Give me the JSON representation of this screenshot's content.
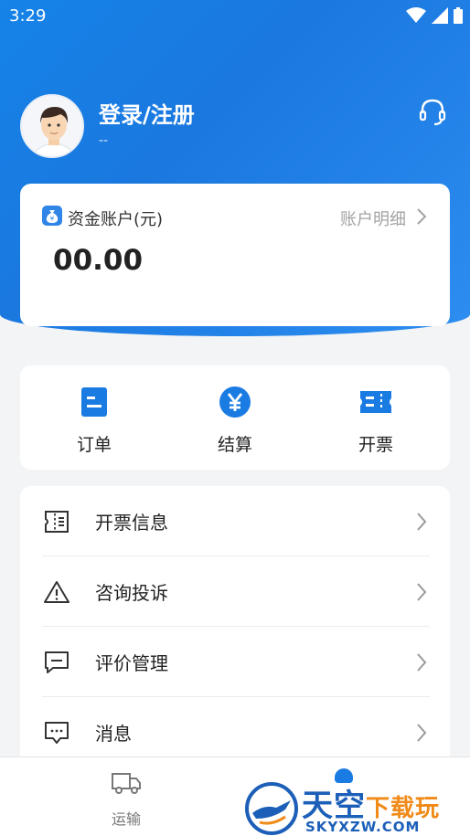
{
  "status_bar": {
    "time": "3:29"
  },
  "profile": {
    "title": "登录/注册",
    "subtitle": "--"
  },
  "account": {
    "label": "资金账户(元)",
    "detail_link": "账户明细",
    "balance": "00.00"
  },
  "quick_actions": [
    {
      "label": "订单",
      "icon": "order-icon"
    },
    {
      "label": "结算",
      "icon": "yuan-icon"
    },
    {
      "label": "开票",
      "icon": "ticket-icon"
    }
  ],
  "menu": [
    {
      "label": "开票信息",
      "icon": "invoice-info-icon"
    },
    {
      "label": "咨询投诉",
      "icon": "warning-icon"
    },
    {
      "label": "评价管理",
      "icon": "comment-icon"
    },
    {
      "label": "消息",
      "icon": "message-icon"
    }
  ],
  "tabbar": {
    "transport_label": "运输"
  },
  "watermark": {
    "title_blue": "天空",
    "title_orange": "下载玩",
    "domain": "SKYXZW.COM"
  },
  "colors": {
    "primary": "#1a7be3",
    "background": "#f3f4f6"
  }
}
